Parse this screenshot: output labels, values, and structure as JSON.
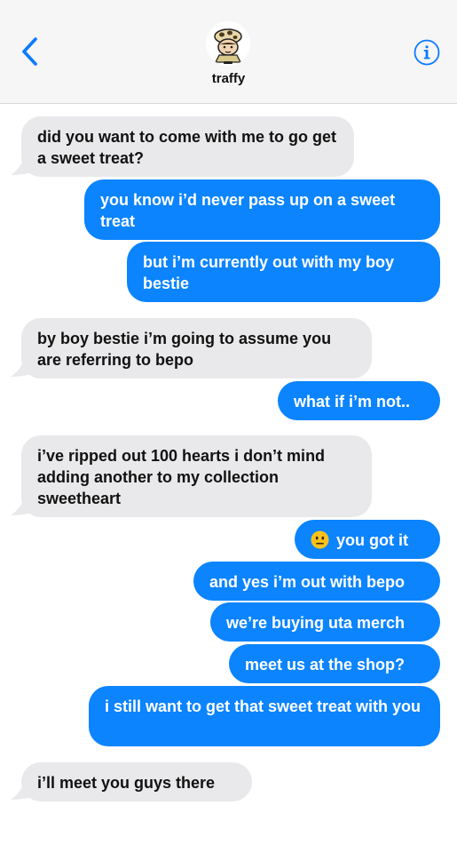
{
  "header": {
    "contact_name": "traffy",
    "back_icon": "chevron-left-icon",
    "info_icon": "info-icon"
  },
  "colors": {
    "outgoing_bubble": "#0b84fe",
    "incoming_bubble": "#e9e9eb",
    "accent": "#0a7aff"
  },
  "messages": [
    {
      "direction": "in",
      "text": "did you want to come with me to go get a sweet treat?"
    },
    {
      "direction": "out",
      "text": "you know i’d never pass up on a sweet treat"
    },
    {
      "direction": "out",
      "text": "but i’m currently out with my boy bestie"
    },
    {
      "direction": "in",
      "text": "by boy bestie i’m going to assume you are referring to bepo"
    },
    {
      "direction": "out",
      "text": "what if i’m not.."
    },
    {
      "direction": "in",
      "text": "i’ve ripped out 100 hearts i don’t mind adding another to my collection sweetheart"
    },
    {
      "direction": "out",
      "text": "you got it",
      "emoji": "neutral-face-emoji"
    },
    {
      "direction": "out",
      "text": "and yes i’m out with bepo"
    },
    {
      "direction": "out",
      "text": "we’re buying uta merch"
    },
    {
      "direction": "out",
      "text": "meet us at the shop?"
    },
    {
      "direction": "out",
      "text": "i still want to get that sweet treat with you"
    },
    {
      "direction": "in",
      "text": "i’ll meet you guys there"
    }
  ]
}
